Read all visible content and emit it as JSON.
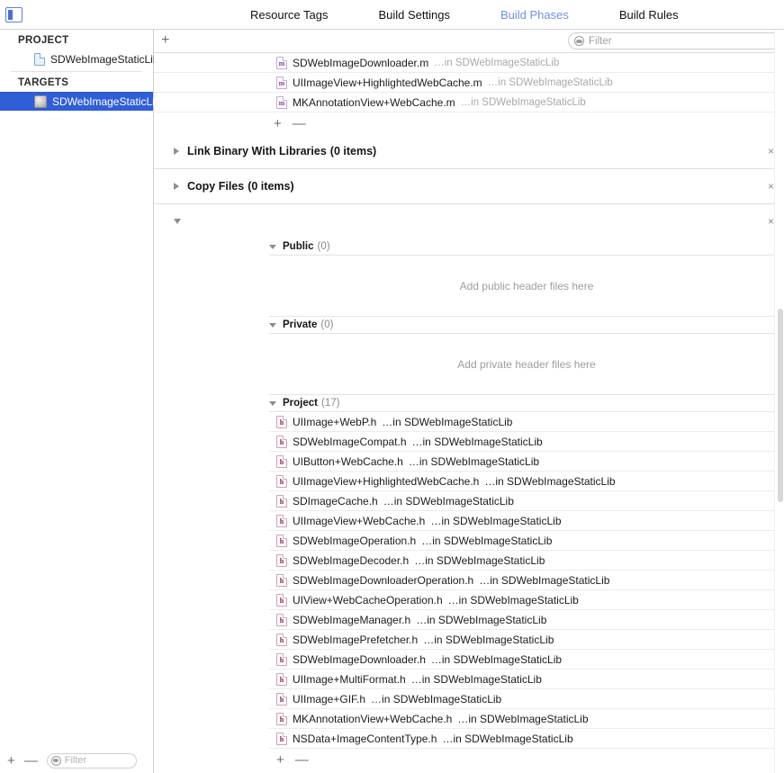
{
  "toolbar": {
    "panel_toggle_icon": "left-panel-toggle-icon",
    "tabs": [
      {
        "label": "Resource Tags",
        "active": false
      },
      {
        "label": "Build Settings",
        "active": false
      },
      {
        "label": "Build Phases",
        "active": true
      },
      {
        "label": "Build Rules",
        "active": false
      }
    ],
    "accent_color": "#6f93dd"
  },
  "sidebar": {
    "project_group_label": "PROJECT",
    "project_items": [
      {
        "label": "SDWebImageStaticLib",
        "icon": "project-document-icon"
      }
    ],
    "targets_group_label": "TARGETS",
    "target_items": [
      {
        "label": "SDWebImageStaticLib",
        "icon": "target-icon",
        "selected": true
      }
    ],
    "selection_color": "#2f5ed6",
    "footer": {
      "add_label": "+",
      "remove_label": "—",
      "filter_placeholder": "Filter",
      "filter_icon": "filter-icon"
    }
  },
  "main": {
    "header": {
      "add_phase_label": "+",
      "filter_placeholder": "Filter",
      "filter_icon": "filter-icon"
    },
    "compile_sources_tail": {
      "files": [
        {
          "icon": "objc-source-icon",
          "type": "m",
          "name": "SDWebImageDownloader.m",
          "location": "…in SDWebImageStaticLib"
        },
        {
          "icon": "objc-source-icon",
          "type": "m",
          "name": "UIImageView+HighlightedWebCache.m",
          "location": "…in SDWebImageStaticLib"
        },
        {
          "icon": "objc-source-icon",
          "type": "m",
          "name": "MKAnnotationView+WebCache.m",
          "location": "…in SDWebImageStaticLib"
        }
      ],
      "add_label": "+",
      "remove_label": "—"
    },
    "phases": [
      {
        "title": "Link Binary With Libraries",
        "count": "(0 items)",
        "expanded": false,
        "close_label": "×"
      },
      {
        "title": "Copy Files",
        "count": "(0 items)",
        "expanded": false,
        "close_label": "×"
      }
    ],
    "headers_phase": {
      "title": "",
      "expanded": true,
      "close_label": "×",
      "sections": [
        {
          "title": "Public",
          "count": "(0)",
          "empty_hint": "Add public header files here",
          "files": []
        },
        {
          "title": "Private",
          "count": "(0)",
          "empty_hint": "Add private header files here",
          "files": []
        },
        {
          "title": "Project",
          "count": "(17)",
          "empty_hint": "",
          "files": [
            {
              "type": "h",
              "icon": "c-header-icon",
              "name": "UIImage+WebP.h",
              "location": "…in SDWebImageStaticLib"
            },
            {
              "type": "h",
              "icon": "c-header-icon",
              "name": "SDWebImageCompat.h",
              "location": "…in SDWebImageStaticLib"
            },
            {
              "type": "h",
              "icon": "c-header-icon",
              "name": "UIButton+WebCache.h",
              "location": "…in SDWebImageStaticLib"
            },
            {
              "type": "h",
              "icon": "c-header-icon",
              "name": "UIImageView+HighlightedWebCache.h",
              "location": "…in SDWebImageStaticLib"
            },
            {
              "type": "h",
              "icon": "c-header-icon",
              "name": "SDImageCache.h",
              "location": "…in SDWebImageStaticLib"
            },
            {
              "type": "h",
              "icon": "c-header-icon",
              "name": "UIImageView+WebCache.h",
              "location": "…in SDWebImageStaticLib"
            },
            {
              "type": "h",
              "icon": "c-header-icon",
              "name": "SDWebImageOperation.h",
              "location": "…in SDWebImageStaticLib"
            },
            {
              "type": "h",
              "icon": "c-header-icon",
              "name": "SDWebImageDecoder.h",
              "location": "…in SDWebImageStaticLib"
            },
            {
              "type": "h",
              "icon": "c-header-icon",
              "name": "SDWebImageDownloaderOperation.h",
              "location": "…in SDWebImageStaticLib"
            },
            {
              "type": "h",
              "icon": "c-header-icon",
              "name": "UIView+WebCacheOperation.h",
              "location": "…in SDWebImageStaticLib"
            },
            {
              "type": "h",
              "icon": "c-header-icon",
              "name": "SDWebImageManager.h",
              "location": "…in SDWebImageStaticLib"
            },
            {
              "type": "h",
              "icon": "c-header-icon",
              "name": "SDWebImagePrefetcher.h",
              "location": "…in SDWebImageStaticLib"
            },
            {
              "type": "h",
              "icon": "c-header-icon",
              "name": "SDWebImageDownloader.h",
              "location": "…in SDWebImageStaticLib"
            },
            {
              "type": "h",
              "icon": "c-header-icon",
              "name": "UIImage+MultiFormat.h",
              "location": "…in SDWebImageStaticLib"
            },
            {
              "type": "h",
              "icon": "c-header-icon",
              "name": "UIImage+GIF.h",
              "location": "…in SDWebImageStaticLib"
            },
            {
              "type": "h",
              "icon": "c-header-icon",
              "name": "MKAnnotationView+WebCache.h",
              "location": "…in SDWebImageStaticLib"
            },
            {
              "type": "h",
              "icon": "c-header-icon",
              "name": "NSData+ImageContentType.h",
              "location": "…in SDWebImageStaticLib"
            }
          ]
        }
      ],
      "footer": {
        "add_label": "+",
        "remove_label": "—"
      }
    }
  }
}
